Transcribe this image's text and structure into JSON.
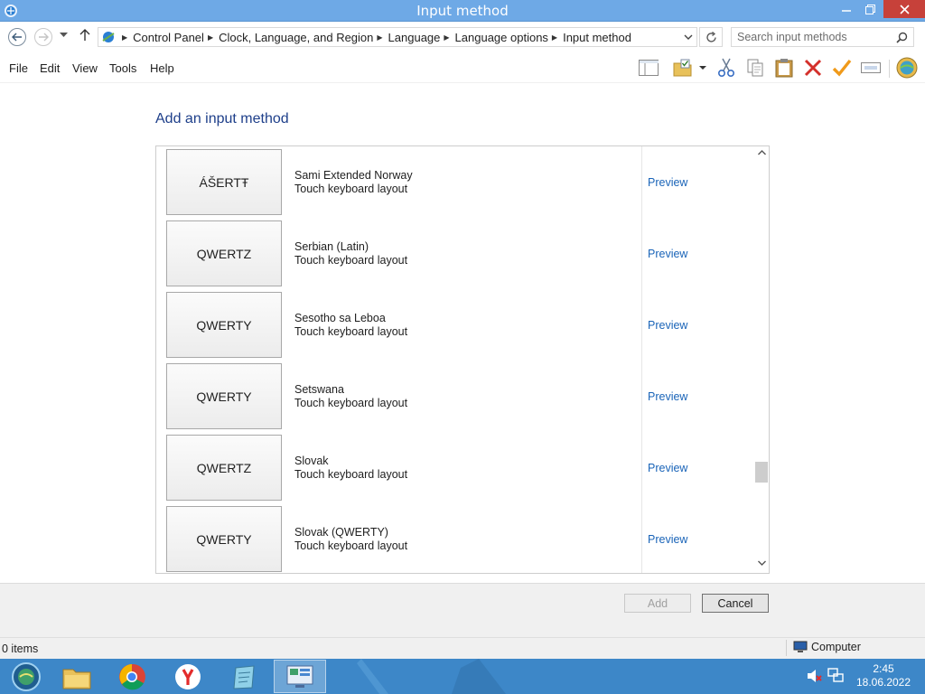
{
  "window": {
    "title": "Input method"
  },
  "address": {
    "breadcrumbs": [
      "Control Panel",
      "Clock, Language, and Region",
      "Language",
      "Language options",
      "Input method"
    ]
  },
  "search": {
    "placeholder": "Search input methods"
  },
  "menu": [
    "File",
    "Edit",
    "View",
    "Tools",
    "Help"
  ],
  "page": {
    "heading": "Add an input method"
  },
  "layouts": [
    {
      "tile": "ÁŠERTŦ",
      "name": "Sami Extended Norway",
      "type": "Touch keyboard layout",
      "link": "Preview"
    },
    {
      "tile": "QWERTZ",
      "name": "Serbian (Latin)",
      "type": "Touch keyboard layout",
      "link": "Preview"
    },
    {
      "tile": "QWERTY",
      "name": "Sesotho sa Leboa",
      "type": "Touch keyboard layout",
      "link": "Preview"
    },
    {
      "tile": "QWERTY",
      "name": "Setswana",
      "type": "Touch keyboard layout",
      "link": "Preview"
    },
    {
      "tile": "QWERTZ",
      "name": "Slovak",
      "type": "Touch keyboard layout",
      "link": "Preview"
    },
    {
      "tile": "QWERTY",
      "name": "Slovak (QWERTY)",
      "type": "Touch keyboard layout",
      "link": "Preview"
    }
  ],
  "buttons": {
    "add": "Add",
    "cancel": "Cancel"
  },
  "status": {
    "items": "0 items",
    "location": "Computer"
  },
  "taskbar": {
    "time": "2:45",
    "date": "18.06.2022"
  },
  "colors": {
    "titlebar": "#6ea9e6",
    "taskbar": "#3d87c8",
    "link": "#1a64b8",
    "heading": "#1e3f8a"
  }
}
